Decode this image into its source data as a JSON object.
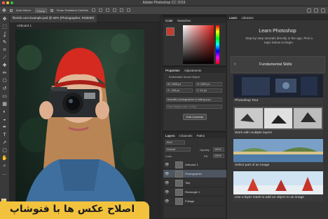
{
  "window": {
    "title": "Adobe Photoshop CC 2019",
    "traffic_colors": [
      "#ff5f56",
      "#ffbd2e",
      "#27c93f"
    ]
  },
  "options_bar": {
    "auto_select_label": "Auto-Select:",
    "auto_select_value": "Group",
    "show_transform_label": "Show Transform Controls"
  },
  "document": {
    "tab_label": "fileInfo.com Example.psd @ 60% (Photographer, RGB/8#)",
    "artboard_label": "Artboard 1"
  },
  "toolbar": {
    "tools": [
      "move-icon",
      "marquee-icon",
      "lasso-icon",
      "quick-select-icon",
      "crop-icon",
      "eyedropper-icon",
      "healing-icon",
      "brush-icon",
      "stamp-icon",
      "history-brush-icon",
      "eraser-icon",
      "gradient-icon",
      "blur-icon",
      "dodge-icon",
      "pen-icon",
      "type-icon",
      "path-select-icon",
      "shape-icon",
      "hand-icon",
      "zoom-icon",
      "more-tools-icon"
    ],
    "glyphs": [
      "✥",
      "⬚",
      "ʆ",
      "✎",
      "⌗",
      "⟋",
      "✚",
      "✏",
      "⎔",
      "↺",
      "▭",
      "▦",
      "◐",
      "◒",
      "✒",
      "T",
      "➚",
      "▢",
      "✋",
      "⌕",
      "…"
    ],
    "foreground_color": "#f0c63d",
    "background_color": "#ffffff"
  },
  "color_panel": {
    "tabs": [
      "Color",
      "Swatches"
    ],
    "current_color": "#c43d2f"
  },
  "properties_panel": {
    "tabs": [
      "Properties",
      "Adjustments"
    ],
    "smart_object_label": "Embedded Smart Object",
    "w": "W: 1508 px",
    "h": "H: 1003 px",
    "x": "X: -105 px",
    "y": "Y: 14 px",
    "file_name": "beautiful-photographer-is-taking-a-pi...",
    "layer_comp": "Don't Apply Layer Comp",
    "edit_contents_label": "Edit Contents"
  },
  "layers_panel": {
    "tabs": [
      "Layers",
      "Channels",
      "Paths"
    ],
    "filter_label": "Kind",
    "blend_mode": "Normal",
    "opacity_label": "Opacity:",
    "opacity_value": "100%",
    "lock_label": "Lock:",
    "fill_label": "Fill:",
    "fill_value": "100%",
    "layers": [
      {
        "name": "Artboard 1",
        "selected": false
      },
      {
        "name": "Photographer",
        "selected": true
      },
      {
        "name": "Title",
        "selected": false
      },
      {
        "name": "Rectangle 1",
        "selected": false
      },
      {
        "name": "Foliage",
        "selected": false
      }
    ]
  },
  "learn_panel": {
    "tabs": [
      "Learn",
      "Libraries"
    ],
    "title": "Learn Photoshop",
    "description": "Step-by-step tutorials directly in the app. Pick a topic below to begin.",
    "topic": "Fundamental Skills",
    "tutorials": [
      {
        "caption": "Photoshop Tour"
      },
      {
        "caption": "Work with multiple layers"
      },
      {
        "caption": "Select part of an image"
      },
      {
        "caption": "Use a layer mask to add an object to an image"
      }
    ]
  },
  "overlay": {
    "text": "اصلاح عکس ها با فتوشاپ",
    "color": "#f2c23d"
  }
}
